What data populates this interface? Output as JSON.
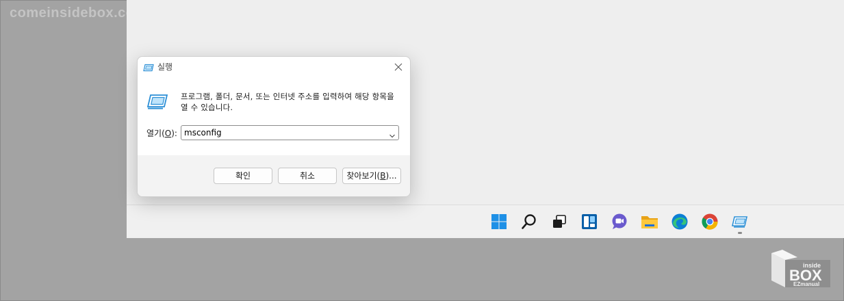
{
  "watermark": "comeinsidebox.com",
  "dialog": {
    "title": "실행",
    "prompt": "프로그램, 폴더, 문서, 또는 인터넷 주소를 입력하여 해당 항목을 열 수 있습니다.",
    "open_label_prefix": "열기(",
    "open_label_key": "O",
    "open_label_suffix": "):",
    "open_value": "msconfig",
    "buttons": {
      "ok": "확인",
      "cancel": "취소",
      "browse_prefix": "찾아보기(",
      "browse_key": "B",
      "browse_suffix": ")..."
    }
  },
  "taskbar": {
    "icons": [
      "windows-start-icon",
      "search-icon",
      "task-view-icon",
      "widgets-icon",
      "teams-chat-icon",
      "file-explorer-icon",
      "edge-icon",
      "chrome-icon",
      "run-app-icon"
    ],
    "active_app": "run-app-icon"
  },
  "logo": {
    "line1": "inside",
    "line2": "BOX",
    "line3": "EZmanual"
  },
  "colors": {
    "background": "#a3a3a3",
    "desktop": "#eeeeee",
    "windows_blue": "#0078d4"
  }
}
